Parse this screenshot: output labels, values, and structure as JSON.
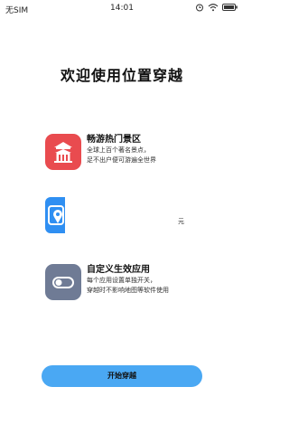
{
  "status_bar": {
    "carrier": "无SIM",
    "time": "14:01",
    "icons": [
      "alarm-icon",
      "wifi-icon",
      "battery-icon"
    ]
  },
  "title": "欢迎使用位置穿越",
  "features": [
    {
      "icon": "palace-icon",
      "title": "畅游热门景区",
      "desc_line1": "全球上百个著名景点，",
      "desc_line2": "足不出户便可游遍全世界"
    },
    {
      "icon": "location-pin-icon",
      "title": "",
      "desc_line1": "元",
      "desc_line2": ""
    },
    {
      "icon": "toggle-icon",
      "title": "自定义生效应用",
      "desc_line1": "每个应用设置单独开关，",
      "desc_line2": "穿越时不影响地图等软件使用"
    }
  ],
  "start_button": "开始穿越",
  "colors": {
    "feature1_icon": "#e94b4f",
    "feature2_icon": "#2f8ff2",
    "feature3_icon": "#6f7b95",
    "button": "#4aa8f3"
  }
}
